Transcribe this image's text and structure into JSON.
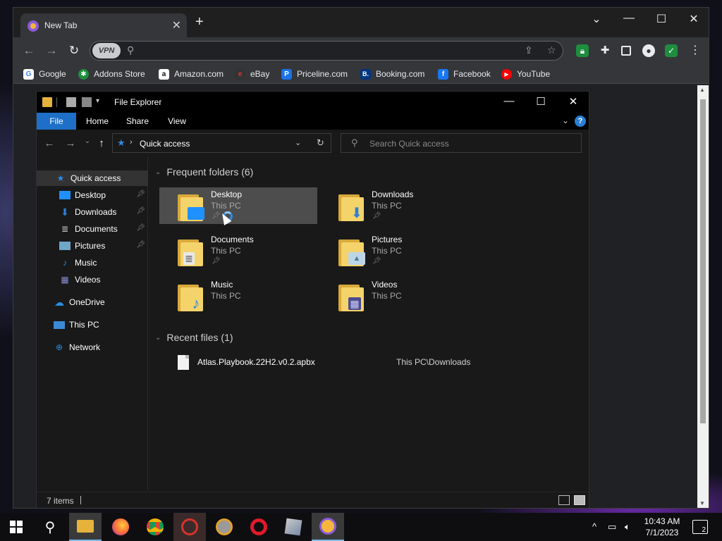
{
  "browser": {
    "tab_title": "New Tab",
    "tab_close": "✕",
    "new_tab": "+",
    "window_controls": {
      "dropdown": "⌄",
      "minimize": "—",
      "maximize": "☐",
      "close": "✕"
    },
    "vpn_label": "VPN",
    "bookmarks": [
      {
        "label": "Google",
        "icon": "google-icon",
        "color": "#ffffff",
        "glyph": "G"
      },
      {
        "label": "Addons Store",
        "icon": "addons-store-icon",
        "color": "#1e8e3e",
        "glyph": "✱"
      },
      {
        "label": "Amazon.com",
        "icon": "amazon-icon",
        "color": "#ffffff",
        "glyph": "a"
      },
      {
        "label": "eBay",
        "icon": "ebay-icon",
        "color": "#e53238",
        "glyph": "e"
      },
      {
        "label": "Priceline.com",
        "icon": "priceline-icon",
        "color": "#1a73e8",
        "glyph": "P"
      },
      {
        "label": "Booking.com",
        "icon": "booking-icon",
        "color": "#003580",
        "glyph": "B."
      },
      {
        "label": "Facebook",
        "icon": "facebook-icon",
        "color": "#1877f2",
        "glyph": "f"
      },
      {
        "label": "YouTube",
        "icon": "youtube-icon",
        "color": "#ff0000",
        "glyph": "▶"
      }
    ]
  },
  "explorer": {
    "title": "File Explorer",
    "ribbon_tabs": [
      "File",
      "Home",
      "Share",
      "View"
    ],
    "address": "Quick access",
    "search_placeholder": "Search Quick access",
    "nav": {
      "quick_access": "Quick access",
      "items": [
        {
          "label": "Desktop",
          "pinned": true,
          "icon": "desktop-icon"
        },
        {
          "label": "Downloads",
          "pinned": true,
          "icon": "downloads-icon"
        },
        {
          "label": "Documents",
          "pinned": true,
          "icon": "documents-icon"
        },
        {
          "label": "Pictures",
          "pinned": true,
          "icon": "pictures-icon"
        },
        {
          "label": "Music",
          "pinned": false,
          "icon": "music-icon"
        },
        {
          "label": "Videos",
          "pinned": false,
          "icon": "videos-icon"
        }
      ],
      "onedrive": "OneDrive",
      "this_pc": "This PC",
      "network": "Network"
    },
    "frequent_header": "Frequent folders (6)",
    "frequent": [
      {
        "name": "Desktop",
        "location": "This PC",
        "pinned": true,
        "badge": "▭",
        "badge_color": "#1e90ff"
      },
      {
        "name": "Downloads",
        "location": "This PC",
        "pinned": true,
        "badge": "⬇",
        "badge_color": "#2d7fd6"
      },
      {
        "name": "Documents",
        "location": "This PC",
        "pinned": true,
        "badge": "≣",
        "badge_color": "#e8e8e8"
      },
      {
        "name": "Pictures",
        "location": "This PC",
        "pinned": true,
        "badge": "▲",
        "badge_color": "#6fa7c9"
      },
      {
        "name": "Music",
        "location": "This PC",
        "pinned": false,
        "badge": "♪",
        "badge_color": "#2a8ee0"
      },
      {
        "name": "Videos",
        "location": "This PC",
        "pinned": false,
        "badge": "▦",
        "badge_color": "#4b4b8c"
      }
    ],
    "recent_header": "Recent files (1)",
    "recent": [
      {
        "name": "Atlas.Playbook.22H2.v0.2.apbx",
        "location": "This PC\\Downloads"
      }
    ],
    "status": "7 items"
  },
  "taskbar": {
    "time": "10:43 AM",
    "date": "7/1/2023",
    "notifications": "2"
  }
}
